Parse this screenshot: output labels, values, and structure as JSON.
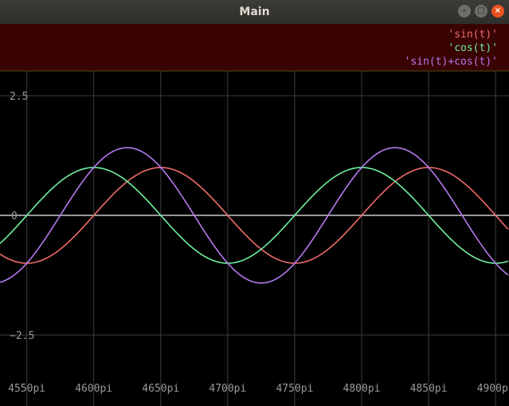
{
  "window": {
    "title": "Main",
    "buttons": [
      "minimize",
      "maximize",
      "close"
    ]
  },
  "chart_data": {
    "type": "line",
    "title": "",
    "xlabel": "",
    "ylabel": "",
    "x_unit": "pi",
    "xlim": [
      4530,
      4910
    ],
    "ylim": [
      -3.8,
      3.0
    ],
    "x_ticks": [
      4550,
      4600,
      4650,
      4700,
      4750,
      4800,
      4850,
      4900
    ],
    "x_tick_labels": [
      "4550pi",
      "4600pi",
      "4650pi",
      "4700pi",
      "4750pi",
      "4800pi",
      "4850pi",
      "4900pi"
    ],
    "y_ticks": [
      2.5,
      0,
      -2.5
    ],
    "y_tick_labels": [
      "2.5",
      "0",
      "−2.5"
    ],
    "grid": true,
    "legend_position": "top-right",
    "period_in_pi_units": 200,
    "series": [
      {
        "name": "'sin(t)'",
        "func": "sin",
        "color": "#ef6b6b"
      },
      {
        "name": "'cos(t)'",
        "func": "cos",
        "color": "#6ef0a0"
      },
      {
        "name": "'sin(t)+cos(t)'",
        "func": "sin+cos",
        "color": "#b57aef"
      }
    ],
    "colors": {
      "background": "#000000",
      "grid": "#3d3d3d",
      "zero_line": "#c8c8c8",
      "legend_bg": "#3a0303",
      "axis_text": "#9a9a9a"
    }
  }
}
